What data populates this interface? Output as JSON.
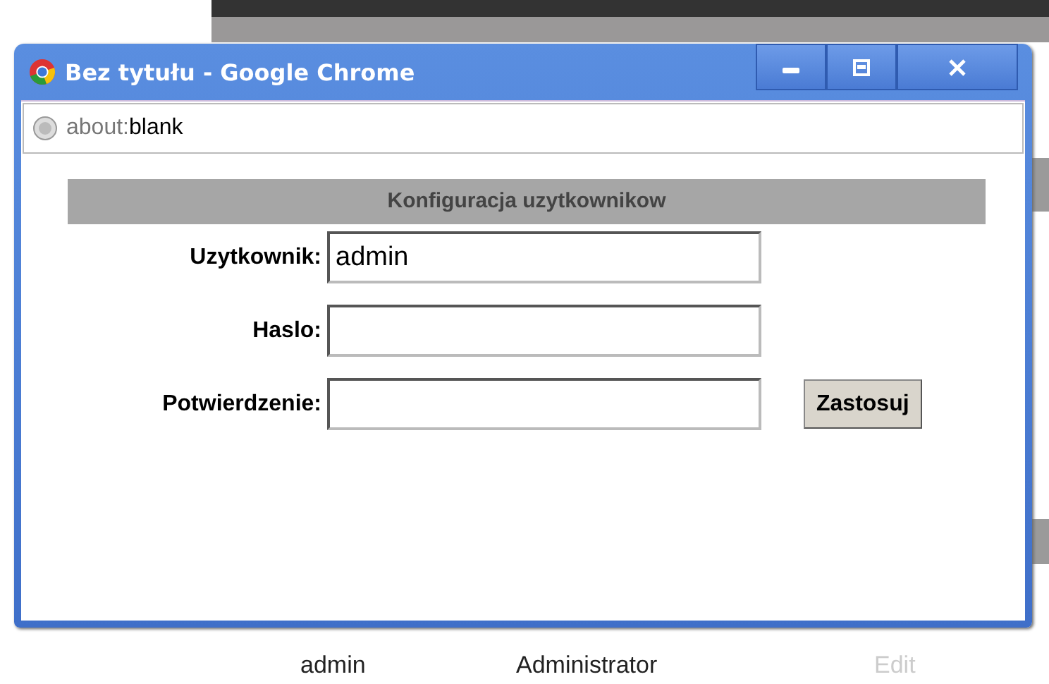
{
  "popup": {
    "title": "Bez tytułu - Google Chrome",
    "address_scheme": "about:",
    "address_path": "blank"
  },
  "form": {
    "heading": "Konfiguracja uzytkownikow",
    "fields": [
      {
        "label": "Uzytkownik:",
        "value": "admin"
      },
      {
        "label": "Haslo:"
      },
      {
        "label": "Potwierdzenie:"
      }
    ],
    "apply_button": "Zastosuj"
  },
  "background_row": {
    "login": "admin",
    "role": "Administrator",
    "action": {
      "label": "Edit",
      "disabled": true
    }
  }
}
